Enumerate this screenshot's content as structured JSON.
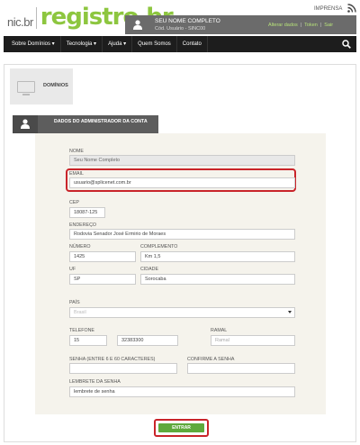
{
  "header": {
    "logo_nic": "nic.br",
    "logo_registro": "registro.br",
    "imprensa": "IMPRENSA",
    "user_name": "SEU NOME COMPLETO",
    "user_code": "Cód. Usuário - SINC00",
    "links": [
      "Alterar dados",
      "Token",
      "Sair"
    ]
  },
  "nav": {
    "items": [
      "Sobre Domínios ▾",
      "Tecnologia ▾",
      "Ajuda ▾",
      "Quem Somos",
      "Contato"
    ]
  },
  "domains_card": {
    "label": "DOMÍNIOS",
    "screen_text": "DOMÍNIOS"
  },
  "section": {
    "title": "DADOS DO ADMINISTRADOR DA CONTA"
  },
  "form": {
    "nome": {
      "label": "NOME",
      "value": "Seu Nome Completo"
    },
    "email": {
      "label": "EMAIL",
      "value": "usuario@splicenet.com.br"
    },
    "cep": {
      "label": "CEP",
      "value": "18087-125"
    },
    "endereco": {
      "label": "ENDEREÇO",
      "value": "Rodovia Senador José Ermirio de Moraes"
    },
    "numero": {
      "label": "NÚMERO",
      "value": "1425"
    },
    "complemento": {
      "label": "COMPLEMENTO",
      "value": "Km 1,5"
    },
    "uf": {
      "label": "UF",
      "value": "SP"
    },
    "cidade": {
      "label": "CIDADE",
      "value": "Sorocaba"
    },
    "pais": {
      "label": "PAÍS",
      "value": "Brasil"
    },
    "telefone": {
      "label": "TELEFONE",
      "ddd": "15",
      "numero": "32383300"
    },
    "ramal": {
      "label": "RAMAL",
      "placeholder": "Ramal"
    },
    "senha": {
      "label": "SENHA (ENTRE 6 E 60 CARACTERES)",
      "value": ""
    },
    "confirme": {
      "label": "CONFIRME A SENHA",
      "value": ""
    },
    "lembrete": {
      "label": "LEMBRETE DA SENHA",
      "value": "lembrete de senha"
    },
    "submit": "ENTRAR"
  },
  "colors": {
    "brand_green": "#8dc63f",
    "highlight_red": "#c9242a",
    "button_green": "#5fa93c"
  }
}
